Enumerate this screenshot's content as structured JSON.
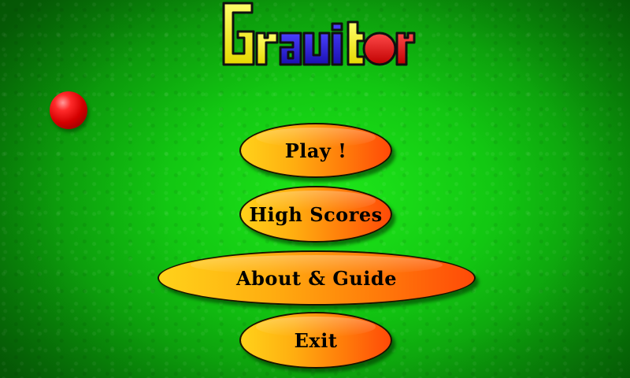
{
  "title": {
    "letters": [
      "G",
      "r",
      "a",
      "v",
      "i",
      "t",
      "o",
      "r"
    ],
    "text": "Gravitor",
    "colors": {
      "yellow": "#f4f000",
      "blue": "#2a1ed8",
      "red": "#e01010",
      "outline": "#101010"
    }
  },
  "menu": {
    "play_label": "Play !",
    "high_scores_label": "High Scores",
    "about_label": "About & Guide",
    "exit_label": "Exit"
  },
  "theme": {
    "background": "#12c712",
    "button_gradient_start": "#ffd21a",
    "button_gradient_end": "#ff4a08",
    "ball_color": "#e00000"
  }
}
